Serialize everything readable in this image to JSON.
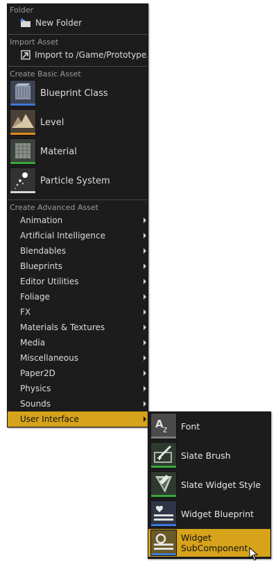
{
  "sections": {
    "folder": "Folder",
    "import_asset": "Import Asset",
    "create_basic": "Create Basic Asset",
    "create_advanced": "Create Advanced Asset"
  },
  "folder_items": [
    {
      "label": "New Folder",
      "icon": "new-folder-icon"
    }
  ],
  "import_items": [
    {
      "label": "Import to /Game/Prototype...",
      "icon": "import-icon"
    }
  ],
  "basic_assets": [
    {
      "label": "Blueprint Class",
      "icon": "blueprint-class-icon",
      "accent": "#3c78d8"
    },
    {
      "label": "Level",
      "icon": "level-icon",
      "accent": "#e08a1e"
    },
    {
      "label": "Material",
      "icon": "material-icon",
      "accent": "#3aa63a"
    },
    {
      "label": "Particle System",
      "icon": "particle-system-icon",
      "accent": "#d8d8d8"
    }
  ],
  "advanced_assets": [
    {
      "label": "Animation"
    },
    {
      "label": "Artificial Intelligence"
    },
    {
      "label": "Blendables"
    },
    {
      "label": "Blueprints"
    },
    {
      "label": "Editor Utilities"
    },
    {
      "label": "Foliage"
    },
    {
      "label": "FX"
    },
    {
      "label": "Materials & Textures"
    },
    {
      "label": "Media"
    },
    {
      "label": "Miscellaneous"
    },
    {
      "label": "Paper2D"
    },
    {
      "label": "Physics"
    },
    {
      "label": "Sounds"
    },
    {
      "label": "User Interface",
      "active": true
    }
  ],
  "user_interface_submenu": [
    {
      "label": "Font",
      "icon": "font-icon",
      "accent": "#7a7a7a"
    },
    {
      "label": "Slate Brush",
      "icon": "slate-brush-icon",
      "accent": "#3aa63a"
    },
    {
      "label": "Slate Widget Style",
      "icon": "slate-widget-style-icon",
      "accent": "#3aa63a"
    },
    {
      "label": "Widget Blueprint",
      "icon": "widget-blueprint-icon",
      "accent": "#3c78d8"
    },
    {
      "label": "Widget SubComponent",
      "icon": "widget-subcomponent-icon",
      "accent": "#3c78d8",
      "highlight": true
    }
  ],
  "colors": {
    "menu_bg": "#1c1c1c",
    "highlight": "#d6a31a",
    "divider": "#4a4a4a",
    "header_text": "#9a9a9a"
  }
}
